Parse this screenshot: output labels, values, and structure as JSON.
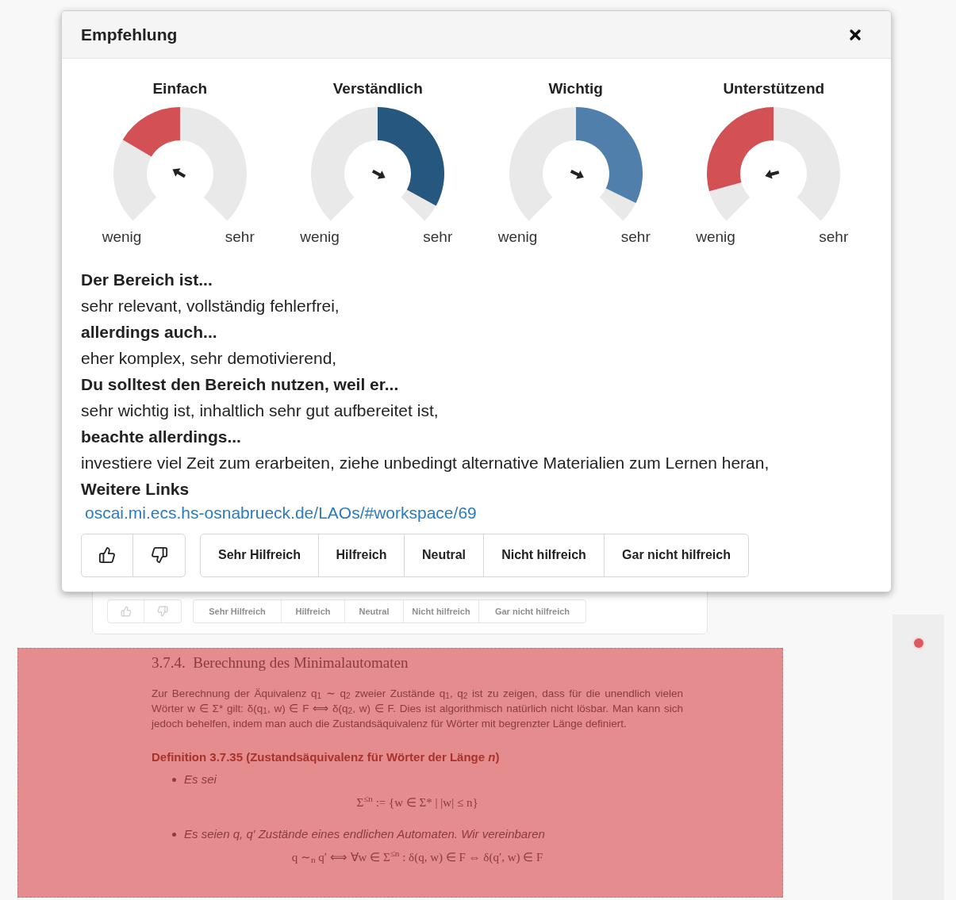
{
  "dialog": {
    "title": "Empfehlung",
    "gauges": [
      {
        "label": "Einfach",
        "level": 0.28,
        "color": "#d35155",
        "low": "wenig",
        "high": "sehr"
      },
      {
        "label": "Verständlich",
        "level": 0.94,
        "color": "#26577f",
        "low": "wenig",
        "high": "sehr"
      },
      {
        "label": "Wichtig",
        "level": 0.93,
        "color": "#4f7faa",
        "low": "wenig",
        "high": "sehr"
      },
      {
        "label": "Unterstützend",
        "level": 0.11,
        "color": "#d35155",
        "low": "wenig",
        "high": "sehr"
      }
    ],
    "summary": [
      {
        "kind": "heading",
        "text": "Der Bereich ist..."
      },
      {
        "kind": "text",
        "text": "sehr relevant, vollständig fehlerfrei,"
      },
      {
        "kind": "heading",
        "text": "allerdings auch..."
      },
      {
        "kind": "text",
        "text": "eher komplex, sehr demotivierend,"
      },
      {
        "kind": "heading",
        "text": "Du solltest den Bereich nutzen, weil er..."
      },
      {
        "kind": "text",
        "text": "sehr wichtig ist, inhaltlich sehr gut aufbereitet ist,"
      },
      {
        "kind": "heading",
        "text": "beachte allerdings..."
      },
      {
        "kind": "text",
        "text": "investiere viel Zeit zum erarbeiten, ziehe unbedingt alternative Materialien zum Lernen heran,"
      },
      {
        "kind": "heading",
        "text": "Weitere Links"
      },
      {
        "kind": "link",
        "text": "oscai.mi.ecs.hs-osnabrueck.de/LAOs/#workspace/69"
      }
    ],
    "ratings": [
      "Sehr Hilfreich",
      "Hilfreich",
      "Neutral",
      "Nicht hilfreich",
      "Gar nicht hilfreich"
    ]
  },
  "background": {
    "popup": {
      "ratings": [
        "Sehr Hilfreich",
        "Hilfreich",
        "Neutral",
        "Nicht hilfreich",
        "Gar nicht hilfreich"
      ]
    },
    "section": {
      "heading": "3.7.4.  Berechnung des Minimalautomaten",
      "paragraph": "Zur Berechnung der Äquivalenz q$_{1}$ ∼ q$_{2}$ zweier Zustände q$_{1}$, q$_{2}$ ist zu zeigen, dass für die unendlich vielen Wörter w ∈ Σ* gilt: δ(q$_{1}$, w) ∈ F ⟺ δ(q$_{2}$, w) ∈ F. Dies ist algorithmisch natürlich nicht lösbar. Man kann sich jedoch behelfen, indem man auch die Zustandsäquivalenz für Wörter mit begrenzter Länge definiert.",
      "definition": "Definition 3.7.35 (Zustandsäquivalenz für Wörter der Länge *n*)",
      "items": [
        {
          "text": "Es sei",
          "formula": "Σ$^{≤n}$ := {w ∈ Σ* | |w| ≤ n}"
        },
        {
          "text": "Es seien q, q′ Zustände eines endlichen Automaten. Wir vereinbaren",
          "formula": "q ∼$_{n}$ q′ ⟺ ∀w ∈ Σ$^{≤n}$ : δ(q, w) ∈ F ⇔ δ(q′, w) ∈ F"
        }
      ]
    }
  }
}
